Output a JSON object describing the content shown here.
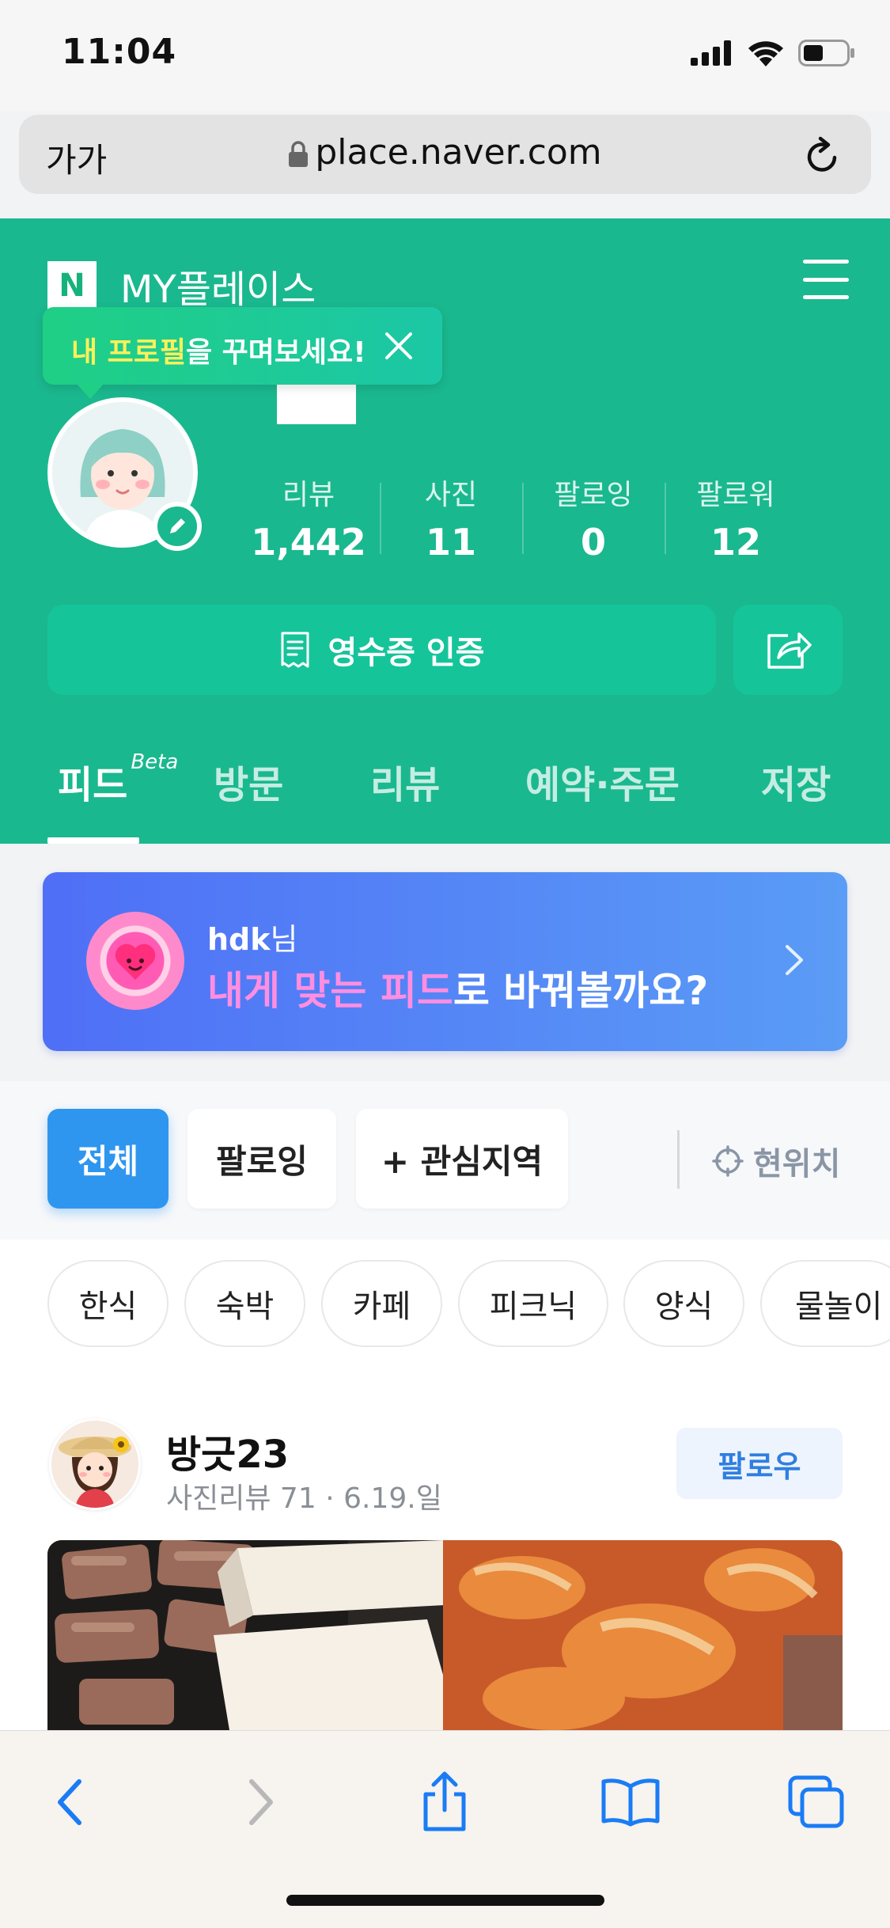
{
  "status_bar": {
    "time": "11:04"
  },
  "address_bar": {
    "text_size_label": "가가",
    "url": "place.naver.com"
  },
  "header": {
    "brand_letter": "N",
    "title": "MY플레이스",
    "tooltip": {
      "highlight": "내 프로필",
      "rest": "을 꾸며보세요!"
    },
    "stats": [
      {
        "label": "리뷰",
        "value": "1,442"
      },
      {
        "label": "사진",
        "value": "11"
      },
      {
        "label": "팔로잉",
        "value": "0"
      },
      {
        "label": "팔로워",
        "value": "12"
      }
    ],
    "receipt_button": "영수증 인증",
    "tabs": [
      {
        "label": "피드",
        "sup": "Beta"
      },
      {
        "label": "방문"
      },
      {
        "label": "리뷰"
      },
      {
        "label": "예약·주문"
      },
      {
        "label": "저장"
      }
    ]
  },
  "promo": {
    "user": "hdk",
    "user_suffix": "님",
    "highlight": "내게 맞는 피드",
    "rest": "로 바꿔볼까요?"
  },
  "filters": {
    "all": "전체",
    "following": "팔로잉",
    "interest": "+ 관심지역",
    "location": "현위치"
  },
  "categories": [
    "한식",
    "숙박",
    "카페",
    "피크닉",
    "양식",
    "물놀이"
  ],
  "post": {
    "author": "방긋23",
    "meta_review": "사진리뷰 71",
    "meta_sep": "·",
    "meta_date": "6.19.일",
    "follow": "팔로우"
  },
  "colors": {
    "brand_green": "#1ab88e",
    "active_blue": "#2f96ef",
    "promo_blue": "#4f6ff6",
    "promo_pink": "#ff8ee0"
  }
}
